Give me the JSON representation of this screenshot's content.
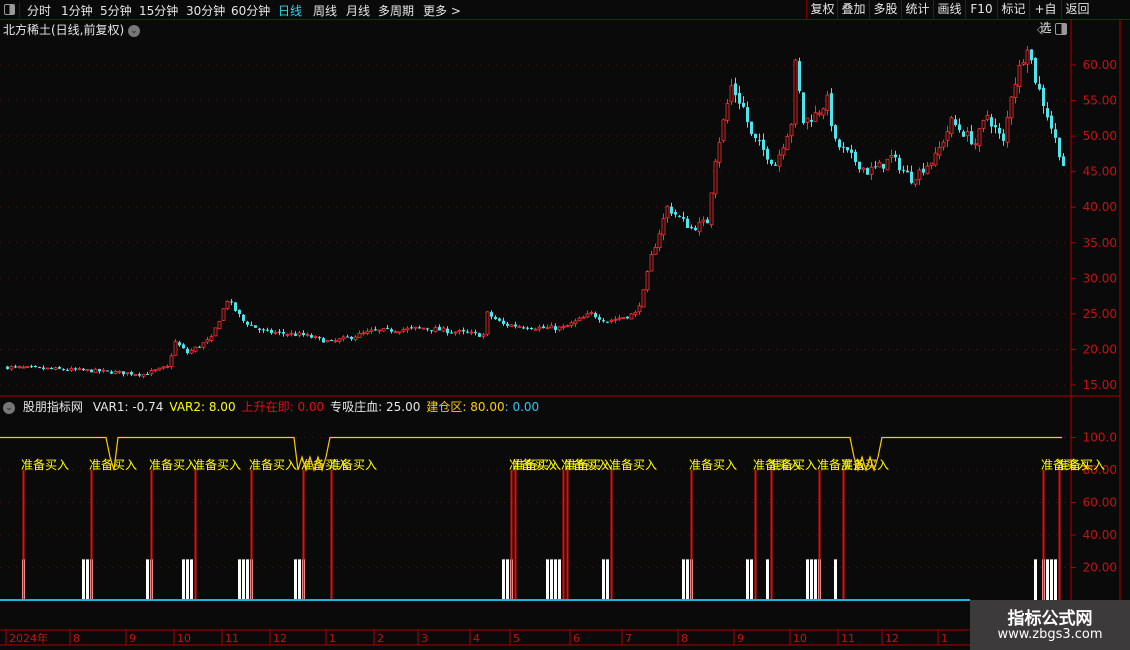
{
  "toolbar": {
    "periods": [
      "分时",
      "1分钟",
      "5分钟",
      "15分钟",
      "30分钟",
      "60分钟",
      "日线",
      "周线",
      "月线",
      "多周期",
      "更多 >"
    ],
    "active_period": "日线",
    "buttons": [
      "复权",
      "叠加",
      "多股",
      "统计",
      "画线",
      "F10",
      "标记",
      "+自选",
      "返回"
    ]
  },
  "stock": {
    "title": "北方稀土(日线,前复权)"
  },
  "indicator": {
    "name": "股朋指标网",
    "values": [
      {
        "label": "VAR1: -0.74",
        "color": "#e6e6e6"
      },
      {
        "label": "VAR2: 8.00",
        "color": "#ffff00"
      },
      {
        "label": "上升在即: ",
        "color": "#e01010"
      },
      {
        "label": "0.00",
        "color": "#e01010"
      },
      {
        "label": "专吸庄血: 25.00",
        "color": "#e6e6e6"
      },
      {
        "label": "建仓区: ",
        "color": "#ffcc00"
      },
      {
        "label": "80.00",
        "color": "#ffcc00"
      },
      {
        "label": ": 0.00",
        "color": "#2fc6f0"
      }
    ],
    "signal_label": "准备买入"
  },
  "colors": {
    "up": "#ff3030",
    "down": "#4ee6ee",
    "axis": "#b00000",
    "line": "#ffcc00",
    "signal": "#ffff00",
    "base": "#19b7e0"
  },
  "chart_data": [
    {
      "type": "candlestick",
      "price_ticks": [
        "60.00",
        "55.00",
        "50.00",
        "45.00",
        "40.00",
        "35.00",
        "30.00",
        "25.00",
        "20.00",
        "15.00"
      ],
      "ylim": [
        13.5,
        64
      ],
      "price_path_bar_price": [
        [
          0,
          17.5
        ],
        [
          21,
          17
        ],
        [
          34,
          16.5
        ],
        [
          40,
          17.5
        ],
        [
          42,
          21
        ],
        [
          45,
          19.5
        ],
        [
          51,
          21.5
        ],
        [
          55,
          27
        ],
        [
          59,
          24
        ],
        [
          64,
          22.5
        ],
        [
          74,
          22
        ],
        [
          81,
          21
        ],
        [
          91,
          22.5
        ],
        [
          104,
          23
        ],
        [
          119,
          22
        ],
        [
          120,
          25
        ],
        [
          124,
          23.5
        ],
        [
          134,
          23
        ],
        [
          139,
          23
        ],
        [
          146,
          25
        ],
        [
          150,
          24
        ],
        [
          157,
          25
        ],
        [
          159,
          28
        ],
        [
          161,
          33
        ],
        [
          165,
          40
        ],
        [
          171,
          37
        ],
        [
          175,
          38
        ],
        [
          177,
          47
        ],
        [
          181,
          57
        ],
        [
          184,
          54
        ],
        [
          186,
          50
        ],
        [
          192,
          46
        ],
        [
          196,
          52
        ],
        [
          197,
          60
        ],
        [
          199,
          52
        ],
        [
          202,
          53
        ],
        [
          205,
          55
        ],
        [
          207,
          49
        ],
        [
          215,
          45
        ],
        [
          219,
          46
        ],
        [
          221,
          47
        ],
        [
          226,
          44
        ],
        [
          232,
          47
        ],
        [
          236,
          52
        ],
        [
          242,
          49
        ],
        [
          245,
          53
        ],
        [
          249,
          49
        ],
        [
          251,
          56
        ],
        [
          255,
          63
        ],
        [
          257,
          58
        ],
        [
          260,
          53
        ],
        [
          264,
          46
        ]
      ]
    },
    {
      "type": "indicator",
      "ticks": [
        "100.0",
        "80.00",
        "60.00",
        "40.00",
        "20.00"
      ],
      "ylim": [
        0,
        115
      ],
      "line_dips_bar": [
        [
          25,
          28,
          80
        ],
        [
          72,
          81,
          80
        ],
        [
          211,
          219,
          80
        ]
      ],
      "signal_bars": [
        4,
        21,
        36,
        47,
        61,
        74,
        81,
        126,
        127,
        139,
        140,
        151,
        171,
        187,
        191,
        203,
        209,
        259,
        263
      ],
      "accumulation_bars": [
        4,
        19,
        20,
        21,
        35,
        36,
        44,
        45,
        46,
        58,
        59,
        60,
        61,
        72,
        73,
        74,
        124,
        125,
        126,
        135,
        136,
        137,
        138,
        149,
        150,
        169,
        170,
        171,
        185,
        186,
        190,
        200,
        201,
        202,
        203,
        207,
        257,
        259,
        260,
        261,
        262
      ],
      "accumulation_value": 25
    }
  ],
  "date_axis": [
    {
      "label": "2024年",
      "bar": 0
    },
    {
      "label": "8",
      "bar": 16
    },
    {
      "label": "9",
      "bar": 30
    },
    {
      "label": "10",
      "bar": 42
    },
    {
      "label": "11",
      "bar": 54
    },
    {
      "label": "12",
      "bar": 66
    },
    {
      "label": "1",
      "bar": 80
    },
    {
      "label": "2",
      "bar": 92
    },
    {
      "label": "3",
      "bar": 103
    },
    {
      "label": "4",
      "bar": 116
    },
    {
      "label": "5",
      "bar": 126
    },
    {
      "label": "6",
      "bar": 141
    },
    {
      "label": "7",
      "bar": 154
    },
    {
      "label": "8",
      "bar": 168
    },
    {
      "label": "9",
      "bar": 182
    },
    {
      "label": "10",
      "bar": 196
    },
    {
      "label": "11",
      "bar": 208
    },
    {
      "label": "12",
      "bar": 219
    },
    {
      "label": "1",
      "bar": 233
    }
  ],
  "watermark": {
    "line1": "指标公式网",
    "line2": "www.zbgs3.com"
  }
}
